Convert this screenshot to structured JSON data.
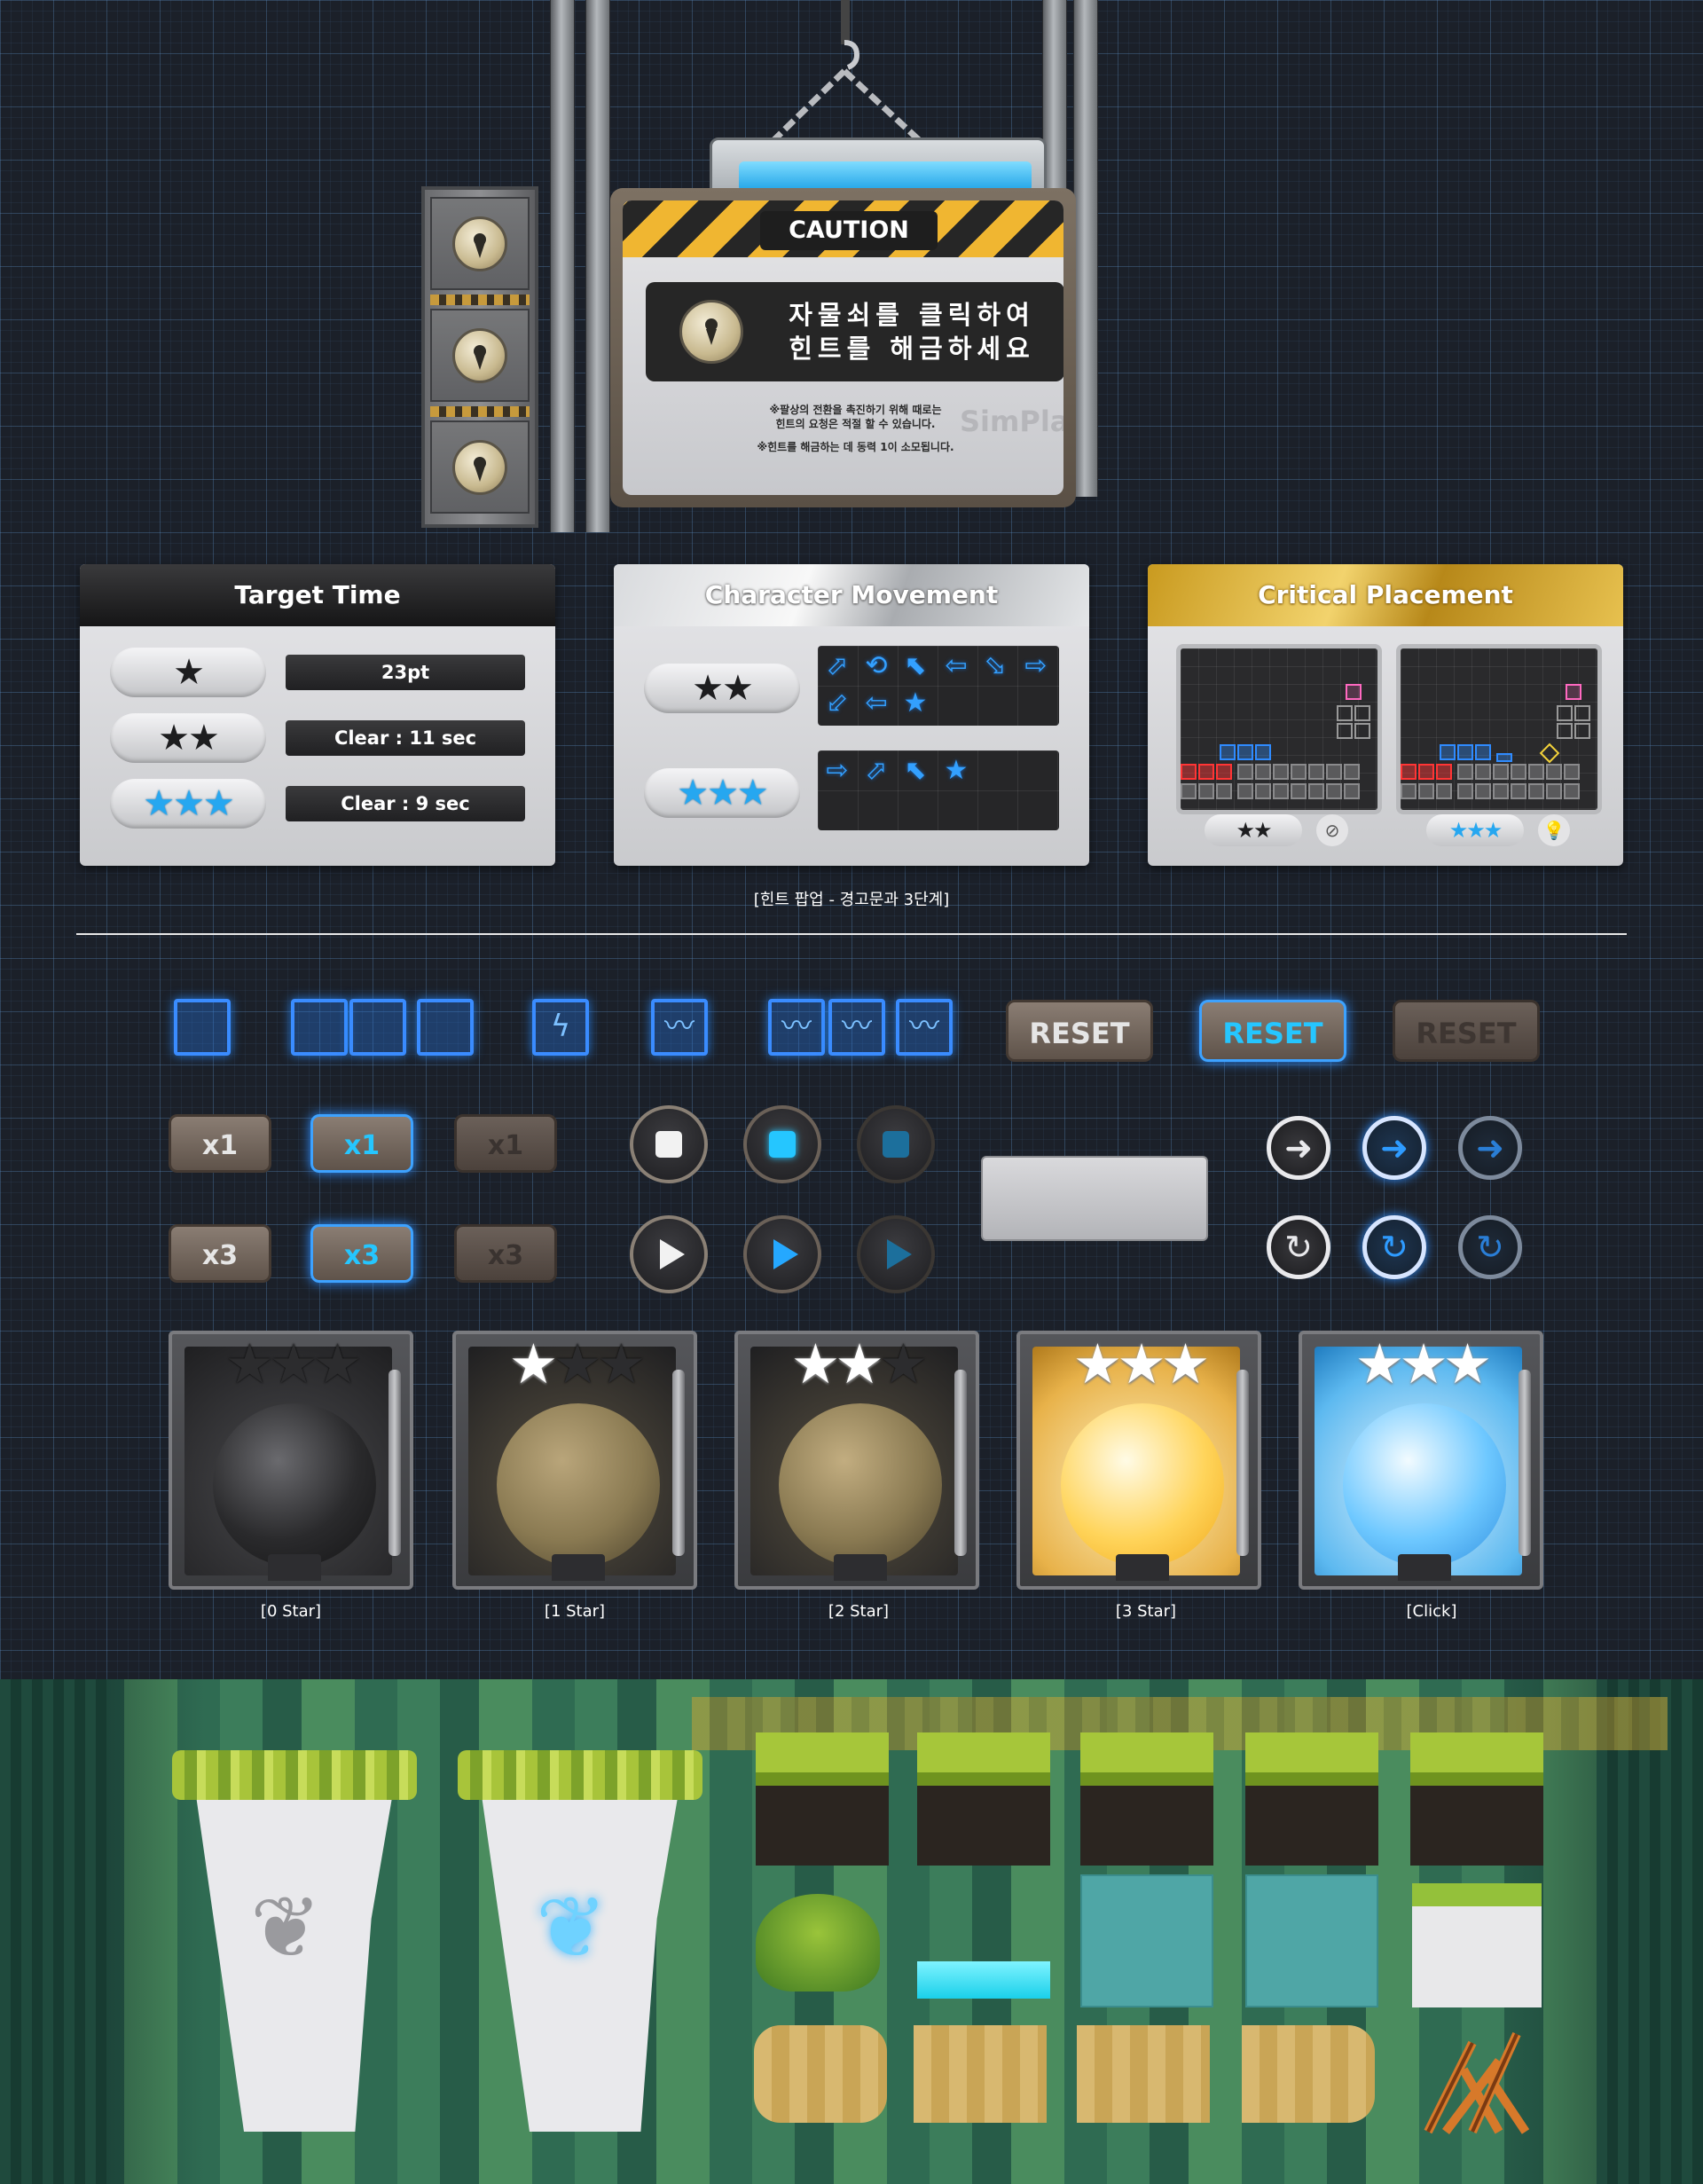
{
  "caution": {
    "tag": "CAUTION",
    "message_line1": "자물쇠를 클릭하여",
    "message_line2": "힌트를 해금하세요",
    "note1_line1": "※팔상의 전환을 촉진하기 위해 때로는",
    "note1_line2": "힌트의 요청은 적절 할 수 있습니다.",
    "note2": "※힌트를 해금하는 데 동력 1이 소모됩니다.",
    "watermark": "SimPlaE",
    "icon": "keyhole-lock-icon"
  },
  "panels": {
    "target_time": {
      "title": "Target Time",
      "rows": [
        {
          "stars": "★",
          "value": "23pt"
        },
        {
          "stars": "★★",
          "value": "Clear : 11 sec"
        },
        {
          "stars": "★★★",
          "value": "Clear : 9 sec"
        }
      ]
    },
    "character_movement": {
      "title": "Character Movement",
      "row1_stars": "★★",
      "row1_arrows_a": [
        "⬀",
        "⟲",
        "⬉",
        "⇦",
        "⬂",
        "⇨"
      ],
      "row1_arrows_b": [
        "⬃",
        "⇦",
        "★"
      ],
      "row2_stars": "★★★",
      "row2_arrows": [
        "⇨",
        "⬀",
        "⬉",
        "★"
      ]
    },
    "critical_placement": {
      "title": "Critical Placement",
      "left_stars": "★★",
      "right_stars": "★★★",
      "left_icon": "⊘",
      "right_icon": "💡"
    }
  },
  "captions": {
    "hint_popup": "[힌트 팝업 - 경고문과 3단계]",
    "star0": "[0 Star]",
    "star1": "[1 Star]",
    "star2": "[2 Star]",
    "star3": "[3 Star]",
    "click": "[Click]"
  },
  "buttons": {
    "reset": "RESET",
    "speed_x1": "x1",
    "speed_x3": "x3",
    "tile_lightning_glyph": "ϟ",
    "tile_wave_glyph": "〰",
    "nav_next_glyph": "➜",
    "nav_retry_glyph": "↻"
  },
  "colors": {
    "accent_blue": "#2d8dff",
    "hazard_yellow": "#f0b631",
    "gold": "#f2d36d",
    "orb_black": "#2a2a2c",
    "orb_bronze": "#8a7a52",
    "orb_yellow": "#ffd45a",
    "orb_blue": "#6ec8ff"
  },
  "orbs": [
    {
      "stars_on": "",
      "stars_off": "★★★"
    },
    {
      "stars_on": "★",
      "stars_off": "★★"
    },
    {
      "stars_on": "★★",
      "stars_off": "★"
    },
    {
      "stars_on": "★★★",
      "stars_off": ""
    },
    {
      "stars_on": "★★★",
      "stars_off": ""
    }
  ],
  "forest": {
    "pedestal_glyph": "❦"
  }
}
